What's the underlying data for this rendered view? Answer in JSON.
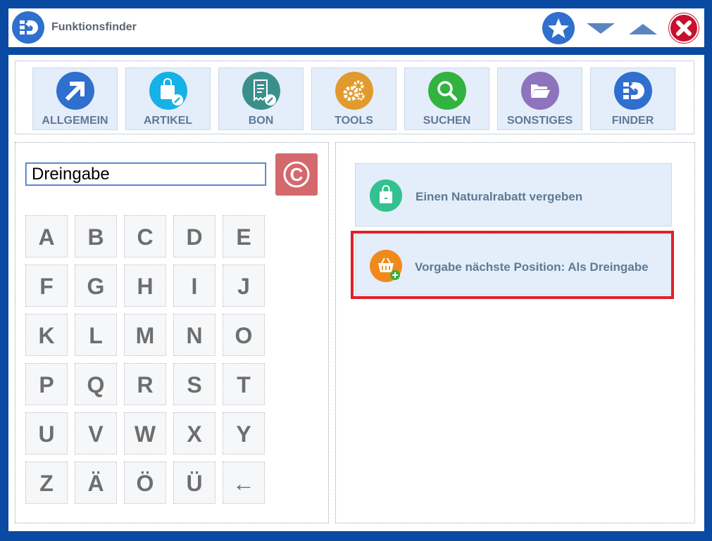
{
  "window": {
    "title": "Funktionsfinder",
    "icons": {
      "app": "finder-logo-icon",
      "favorite": "star-icon",
      "minimize": "chevron-down-icon",
      "maximize": "chevron-up-icon",
      "close": "close-icon"
    },
    "colors": {
      "frame": "#0b4aa2",
      "close": "#c8102e",
      "accent": "#2f6fce"
    }
  },
  "categories": [
    {
      "label": "ALLGEMEIN",
      "icon": "arrow-up-right-icon",
      "color": "#2f6fce"
    },
    {
      "label": "ARTIKEL",
      "icon": "shopping-bag-edit-icon",
      "color": "#16b1e6"
    },
    {
      "label": "BON",
      "icon": "receipt-edit-icon",
      "color": "#3a8f8c"
    },
    {
      "label": "TOOLS",
      "icon": "gears-icon",
      "color": "#e19a2e"
    },
    {
      "label": "SUCHEN",
      "icon": "search-icon",
      "color": "#31b340"
    },
    {
      "label": "SONSTIGES",
      "icon": "folder-open-icon",
      "color": "#8e73bd"
    },
    {
      "label": "FINDER",
      "icon": "finder-logo-icon",
      "color": "#2f6fce"
    }
  ],
  "search": {
    "value": "Dreingabe",
    "clear_label": "C",
    "clear_color": "#d4696d"
  },
  "keyboard": {
    "keys": [
      "A",
      "B",
      "C",
      "D",
      "E",
      "F",
      "G",
      "H",
      "I",
      "J",
      "K",
      "L",
      "M",
      "N",
      "O",
      "P",
      "Q",
      "R",
      "S",
      "T",
      "U",
      "V",
      "W",
      "X",
      "Y",
      "Z",
      "Ä",
      "Ö",
      "Ü",
      "←"
    ]
  },
  "results": [
    {
      "label": "Einen Naturalrabatt vergeben",
      "icon": "shopping-bag-icon",
      "color": "#33c28f"
    },
    {
      "label": "Vorgabe nächste Position: Als Dreingabe",
      "icon": "basket-add-icon",
      "color": "#f08a1c",
      "selected": true
    }
  ]
}
